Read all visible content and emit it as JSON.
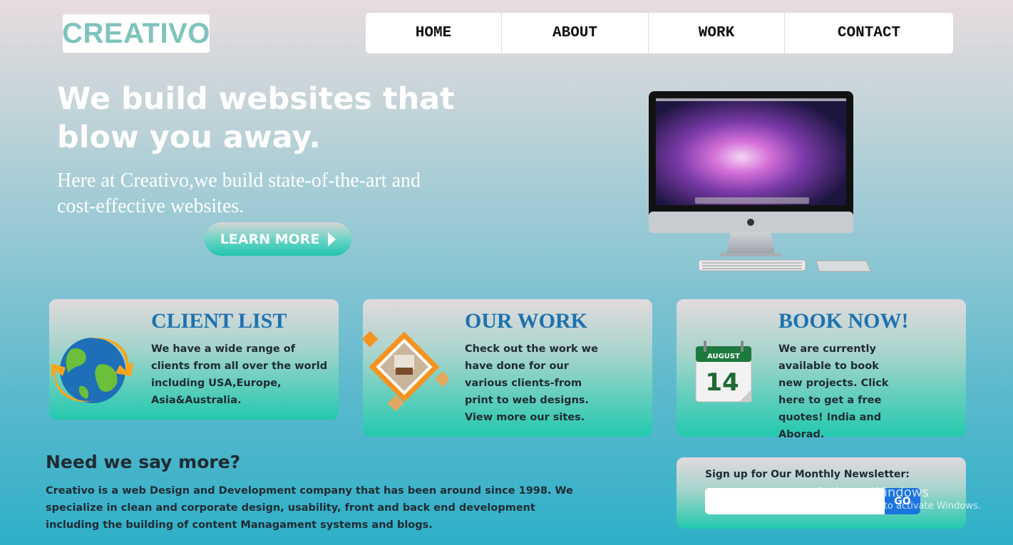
{
  "brand": {
    "logo_text": "CREATIVO"
  },
  "nav": {
    "items": [
      "HOME",
      "ABOUT",
      "WORK",
      "CONTACT"
    ]
  },
  "hero": {
    "title": "We build websites that blow you away.",
    "subtitle": "Here at Creativo,we build state-of-the-art and cost-effective websites.",
    "cta_label": "LEARN MORE"
  },
  "cards": [
    {
      "title": "CLIENT LIST",
      "text": "We have a wide range of clients from all over the world including USA,Europe, Asia&Australia.",
      "icon": "globe-arrows-icon"
    },
    {
      "title": "OUR WORK",
      "text": "Check out the work we have done for our various clients-from print to web designs. View more our sites.",
      "icon": "portfolio-diamond-icon"
    },
    {
      "title": "BOOK NOW!",
      "text": "We are currently available to book new projects. Click here to get a free quotes! India and Aborad.",
      "icon": "calendar-icon",
      "calendar_month": "AUGUST",
      "calendar_day": "14"
    }
  ],
  "about": {
    "title": "Need we say more?",
    "text": "Creativo is a web Design and Development company that has been around since 1998. We specialize in clean and corporate design, usability, front and back end development including the building of content Managament systems and blogs."
  },
  "newsletter": {
    "label": "Sign up for Our Monthly Newsletter:",
    "placeholder": "",
    "button": "GO"
  },
  "watermark": {
    "line1": "Activate Windows",
    "line2": "Go to Settings to activate Windows."
  },
  "colors": {
    "heading_blue": "#1d72b0",
    "teal": "#23c9ae",
    "logo": "#7fc3bd",
    "go_button": "#1b74e0"
  }
}
